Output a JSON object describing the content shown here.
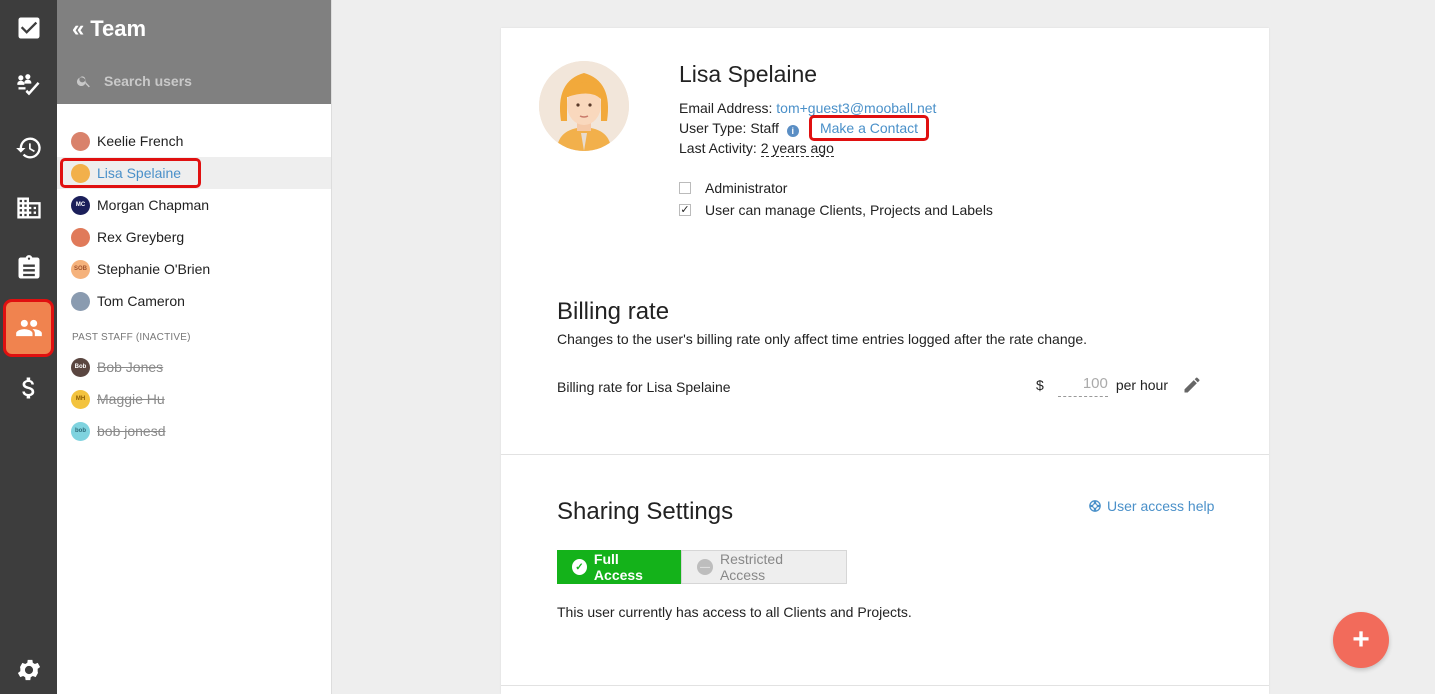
{
  "rail": {
    "items": [
      {
        "name": "tasks-icon"
      },
      {
        "name": "activity-icon"
      },
      {
        "name": "history-icon"
      },
      {
        "name": "clients-icon"
      },
      {
        "name": "reports-icon"
      },
      {
        "name": "team-icon"
      },
      {
        "name": "billing-icon"
      }
    ],
    "settings": "settings-icon"
  },
  "team": {
    "back": "«",
    "title": "Team",
    "search_placeholder": "Search users",
    "users": [
      {
        "name": "Keelie French",
        "color": "#d9826b",
        "initials": ""
      },
      {
        "name": "Lisa Spelaine",
        "color": "#f2b04b",
        "initials": ""
      },
      {
        "name": "Morgan Chapman",
        "color": "#1b1f5a",
        "initials": "MC"
      },
      {
        "name": "Rex Greyberg",
        "color": "#e07a5a",
        "initials": ""
      },
      {
        "name": "Stephanie O'Brien",
        "color": "#f5b27c",
        "initials": "SOB"
      },
      {
        "name": "Tom Cameron",
        "color": "#8a9bb0",
        "initials": ""
      }
    ],
    "past_label": "PAST STAFF (INACTIVE)",
    "past_users": [
      {
        "name": "Bob Jones",
        "color": "#5a4640",
        "initials": "Bob"
      },
      {
        "name": "Maggie Hu",
        "color": "#f3c33e",
        "initials": "MH"
      },
      {
        "name": "bob jonesd",
        "color": "#7fd3df",
        "initials": "bob"
      }
    ]
  },
  "profile": {
    "name": "Lisa Spelaine",
    "email_label": "Email Address:",
    "email": "tom+guest3@mooball.net",
    "type_label": "User Type:",
    "type": "Staff",
    "make_contact": "Make a Contact",
    "activity_label": "Last Activity:",
    "activity": "2 years ago",
    "admin_label": "Administrator",
    "admin_checked": false,
    "manage_label": "User can manage Clients, Projects and Labels",
    "manage_checked": true
  },
  "billing": {
    "title": "Billing rate",
    "description": "Changes to the user's billing rate only affect time entries logged after the rate change.",
    "rate_label": "Billing rate for Lisa Spelaine",
    "currency": "$",
    "rate": "100",
    "unit": "per hour"
  },
  "sharing": {
    "title": "Sharing Settings",
    "help": "User access help",
    "full": "Full Access",
    "restricted": "Restricted Access",
    "status": "This user currently has access to all Clients and Projects."
  },
  "fab": "+"
}
